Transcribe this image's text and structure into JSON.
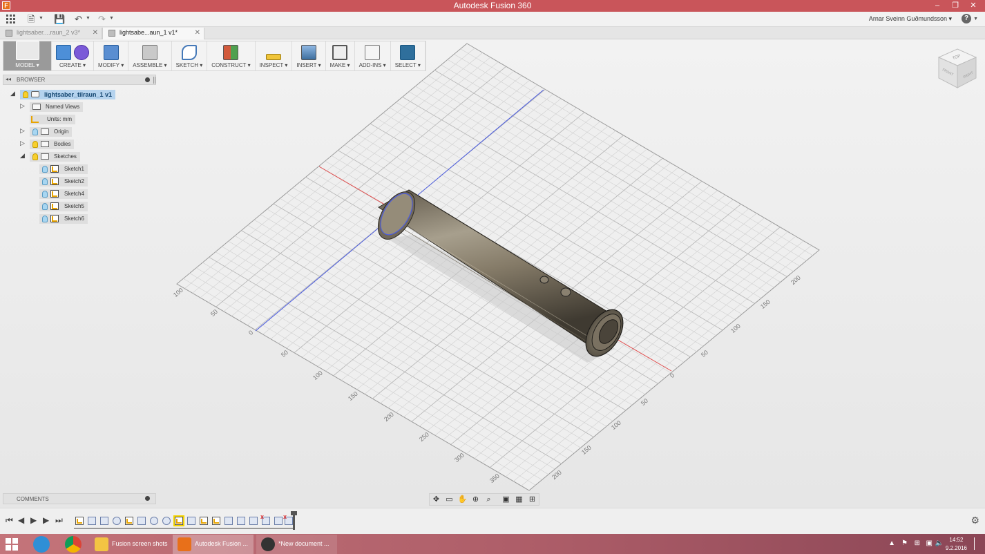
{
  "window": {
    "title": "Autodesk Fusion 360",
    "controls": [
      "–",
      "❐",
      "✕"
    ]
  },
  "topbar": {
    "user": "Arnar Sveinn Guðmundsson ▾",
    "help": "?"
  },
  "doc_tabs": [
    {
      "label": "lightsaber....raun_2 v3*",
      "active": false
    },
    {
      "label": "lightsabe...aun_1 v1*",
      "active": true
    }
  ],
  "toolbar": [
    {
      "label": "MODEL ▾"
    },
    {
      "label": "CREATE ▾"
    },
    {
      "label": "MODIFY ▾"
    },
    {
      "label": "ASSEMBLE ▾"
    },
    {
      "label": "SKETCH ▾"
    },
    {
      "label": "CONSTRUCT ▾"
    },
    {
      "label": "INSPECT ▾"
    },
    {
      "label": "INSERT ▾"
    },
    {
      "label": "MAKE ▾"
    },
    {
      "label": "ADD-INS ▾"
    },
    {
      "label": "SELECT ▾"
    }
  ],
  "browser": {
    "header": "BROWSER",
    "root": "lightsaber_tilraun_1 v1",
    "named_views": "Named Views",
    "units": "Units: mm",
    "origin": "Origin",
    "bodies": "Bodies",
    "sketches": "Sketches",
    "sketch_items": [
      "Sketch1",
      "Sketch2",
      "Sketch4",
      "Sketch5",
      "Sketch6"
    ]
  },
  "comments": {
    "header": "COMMENTS"
  },
  "viewcube": {
    "top": "TOP",
    "front": "FRONT",
    "right": "RIGHT"
  },
  "grid_labels": {
    "left_axis": [
      "100",
      "50",
      "0",
      "50",
      "100",
      "150",
      "200",
      "250",
      "300",
      "350"
    ],
    "right_axis": [
      "200",
      "150",
      "100",
      "50",
      "0",
      "50",
      "100",
      "150",
      "200"
    ]
  },
  "taskbar": {
    "buttons": [
      {
        "label": "Fusion screen shots"
      },
      {
        "label": "Autodesk Fusion ..."
      },
      {
        "label": "*New document ..."
      }
    ],
    "time": "14:52",
    "date": "9.2.2016"
  },
  "colors": {
    "titlebar": "#c9555a",
    "selected_node": "#b5d3ee",
    "axis_red": "#e04b4b",
    "axis_blue": "#4b5ce0",
    "body": "#7d7463"
  }
}
